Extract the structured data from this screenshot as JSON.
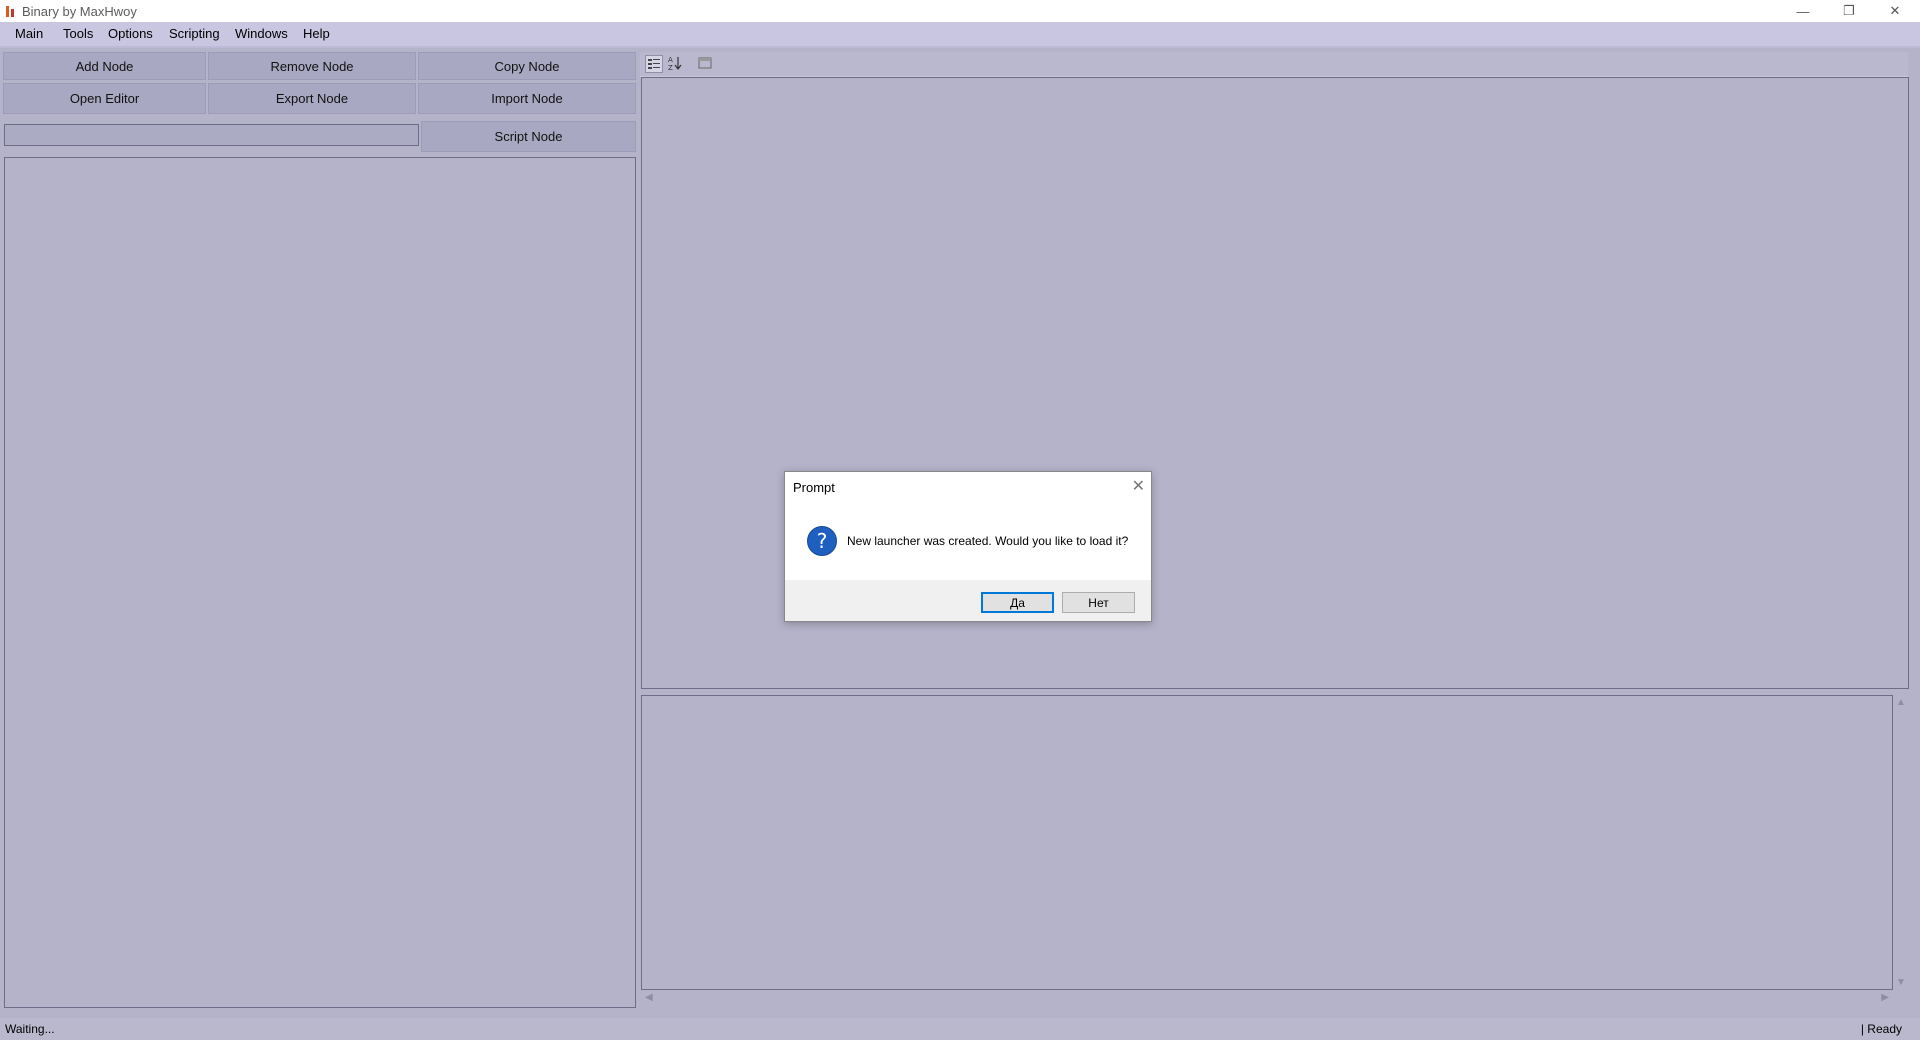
{
  "window": {
    "title": "Binary by MaxHwoy",
    "controls": {
      "minimize": "—",
      "restore": "❐",
      "close": "✕"
    }
  },
  "menu": [
    "Main",
    "Tools",
    "Options",
    "Scripting",
    "Windows",
    "Help"
  ],
  "toolbar": {
    "add_node": "Add Node",
    "remove_node": "Remove Node",
    "copy_node": "Copy Node",
    "open_editor": "Open Editor",
    "export_node": "Export Node",
    "import_node": "Import Node",
    "script_node": "Script Node"
  },
  "search": {
    "value": ""
  },
  "property_toolstrip": {
    "icons": [
      "categorized-icon",
      "alphabetical-icon",
      "property-pages-icon"
    ]
  },
  "scroll": {
    "up": "▲",
    "down": "▼",
    "left": "◀",
    "right": "▶"
  },
  "status": {
    "left": "Waiting...",
    "right": "| Ready"
  },
  "dialog": {
    "title": "Prompt",
    "close": "✕",
    "icon": "question-icon",
    "icon_glyph": "?",
    "message": "New launcher was created. Would you like to load it?",
    "yes_label": "Да",
    "no_label": "Нет"
  },
  "colors": {
    "background": "#b4b3c9",
    "button": "#a9a8c2",
    "menubar": "#c9c6e2",
    "accent": "#0078d7"
  }
}
